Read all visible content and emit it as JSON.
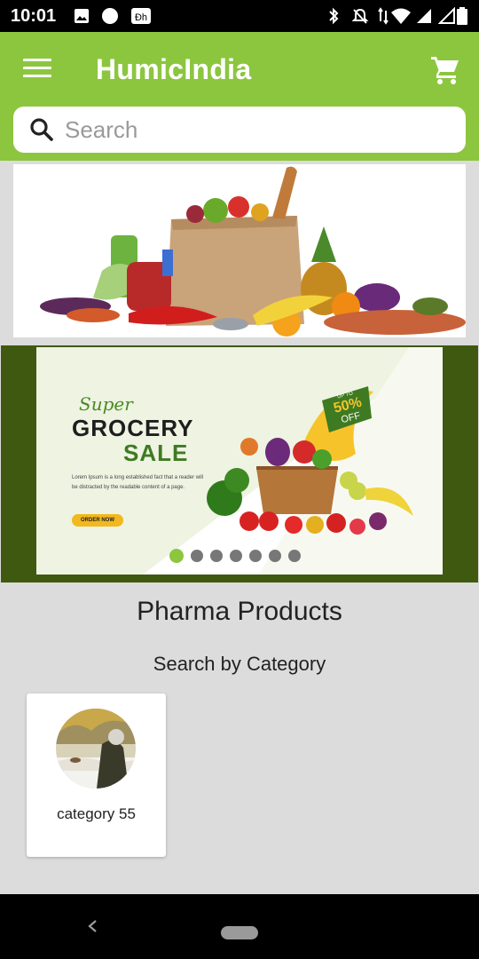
{
  "status_bar": {
    "time": "10:01",
    "left_icons": [
      "image-icon",
      "circle-icon",
      "app-badge-icon"
    ],
    "right_icons": [
      "bluetooth-icon",
      "notifications-off-icon",
      "data-arrows-icon",
      "wifi-icon",
      "signal-icon",
      "battery-icon"
    ]
  },
  "app_bar": {
    "title": "HumicIndia",
    "background_color": "#8cc63f"
  },
  "search": {
    "placeholder": "Search"
  },
  "banner_promo": {
    "heading_script": "Super",
    "heading_line1": "GROCERY",
    "heading_line2": "SALE",
    "body": "Lorem Ipsum is a long established fact that a reader will be distracted by the readable content of a page.",
    "cta": "ORDER NOW",
    "badge_top": "UP TO",
    "badge_value": "50%",
    "badge_bottom": "OFF"
  },
  "carousel": {
    "page_count": 7,
    "active_index": 0
  },
  "main": {
    "title": "Pharma Products",
    "subtitle": "Search by Category"
  },
  "categories": [
    {
      "label": "category 55"
    }
  ]
}
